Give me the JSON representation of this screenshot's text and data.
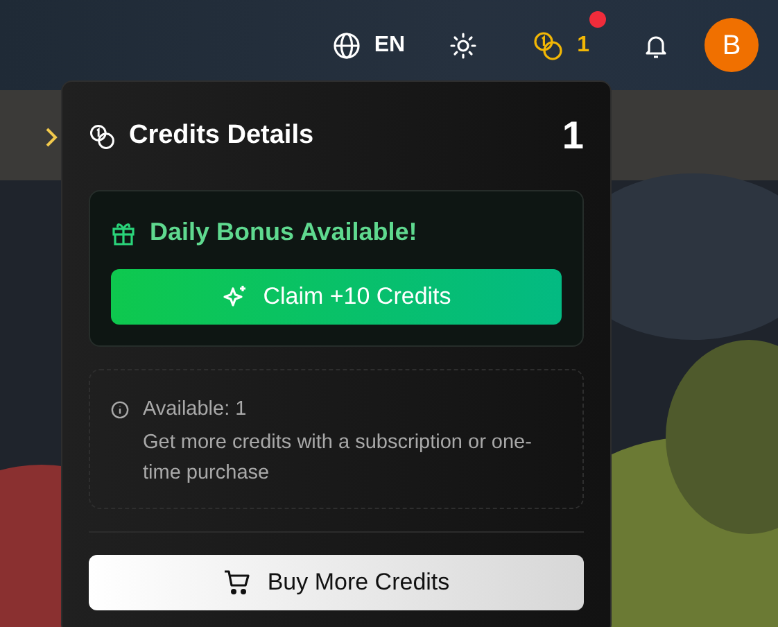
{
  "navbar": {
    "language": "EN",
    "credits": {
      "count": "1",
      "has_notification": true
    },
    "avatar": "B"
  },
  "credits_panel": {
    "title": "Credits Details",
    "balance": "1",
    "daily_bonus": {
      "title": "Daily Bonus Available!",
      "button": "Claim +10 Credits"
    },
    "info": {
      "available": "Available: 1",
      "description": "Get more credits with a subscription or one-time purchase"
    },
    "buy_button": "Buy More Credits"
  }
}
